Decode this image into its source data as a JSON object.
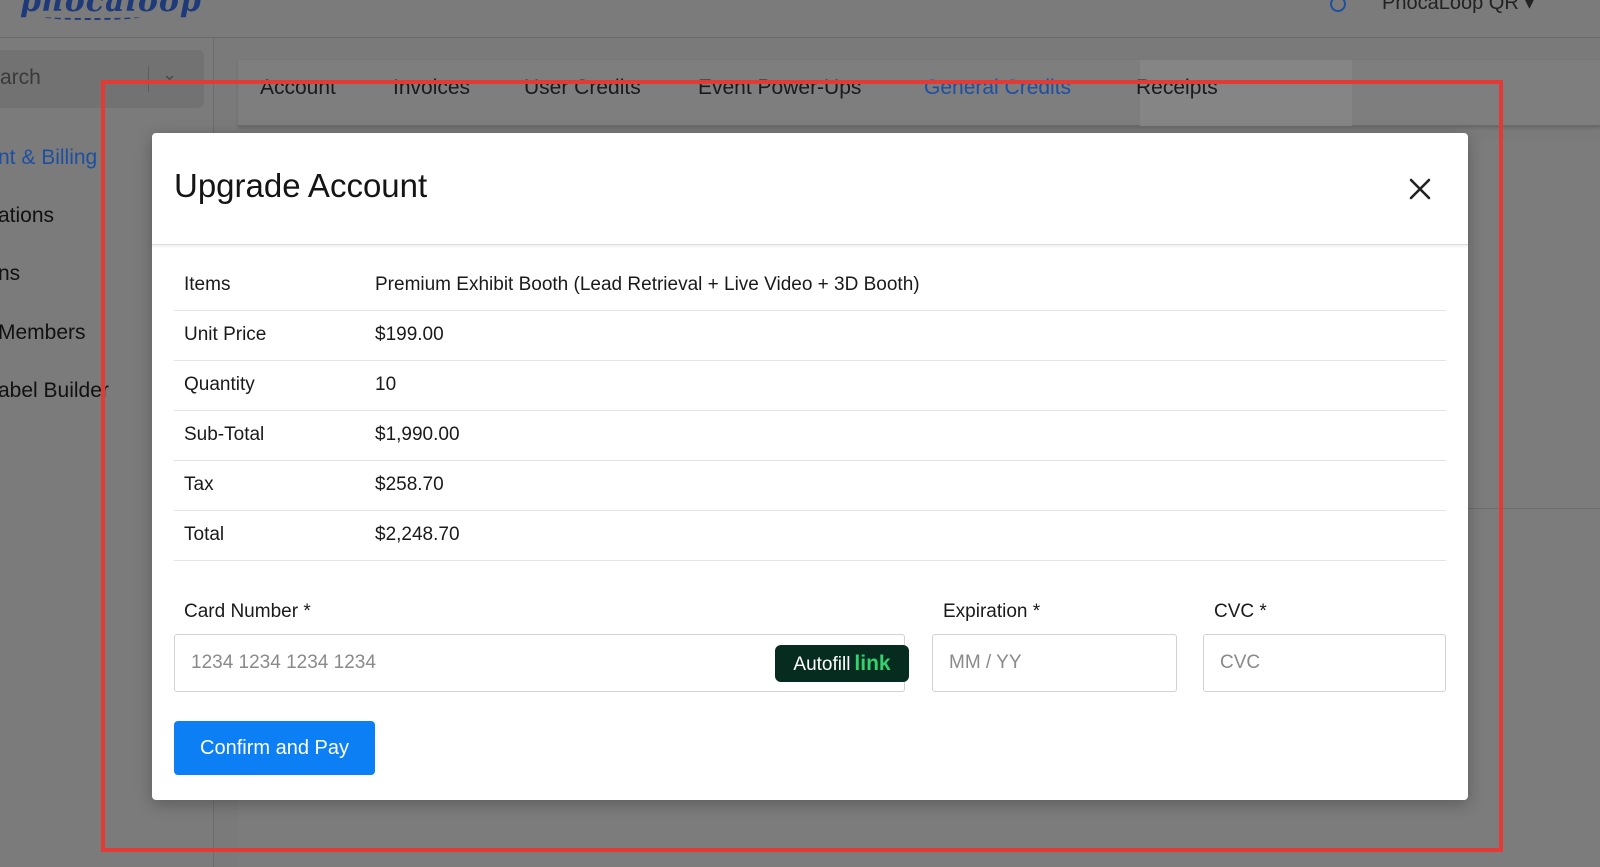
{
  "app": {
    "logo_text": "phocaloop",
    "user_name": "PhocaLoop QR",
    "user_menu_chevron": "▾"
  },
  "sidebar": {
    "search_label": "arch",
    "search_chevron": "⌄",
    "items": [
      {
        "label": "nt & Billing",
        "active": true
      },
      {
        "label": "ations",
        "active": false
      },
      {
        "label": "ns",
        "active": false
      },
      {
        "label": "Members",
        "active": false
      },
      {
        "label": "abel Builder",
        "active": false
      }
    ]
  },
  "tabs": [
    {
      "label": "Account",
      "active": false
    },
    {
      "label": "Invoices",
      "active": false
    },
    {
      "label": "User Credits",
      "active": false
    },
    {
      "label": "Event Power-Ups",
      "active": false
    },
    {
      "label": "General Credits",
      "active": true
    },
    {
      "label": "Receipts",
      "active": false
    }
  ],
  "modal": {
    "title": "Upgrade Account",
    "close_icon": "close-icon",
    "summary": [
      {
        "label": "Items",
        "value": "Premium Exhibit Booth (Lead Retrieval + Live Video + 3D Booth)"
      },
      {
        "label": "Unit Price",
        "value": "$199.00"
      },
      {
        "label": "Quantity",
        "value": "10"
      },
      {
        "label": "Sub-Total",
        "value": "$1,990.00"
      },
      {
        "label": "Tax",
        "value": "$258.70"
      },
      {
        "label": "Total",
        "value": "$2,248.70"
      }
    ],
    "card_number": {
      "label": "Card Number *",
      "placeholder": "1234 1234 1234 1234",
      "value": ""
    },
    "autofill": {
      "label": "Autofill",
      "brand": "link"
    },
    "expiration": {
      "label": "Expiration *",
      "placeholder": "MM / YY",
      "value": ""
    },
    "cvc": {
      "label": "CVC *",
      "placeholder": "CVC",
      "value": ""
    },
    "confirm_label": "Confirm and Pay"
  },
  "colors": {
    "accent": "#0d7ff5",
    "active_link": "#1e4fa0",
    "highlight_frame": "#e53935",
    "autofill_bg": "#062b1f",
    "autofill_brand": "#33d26f"
  }
}
